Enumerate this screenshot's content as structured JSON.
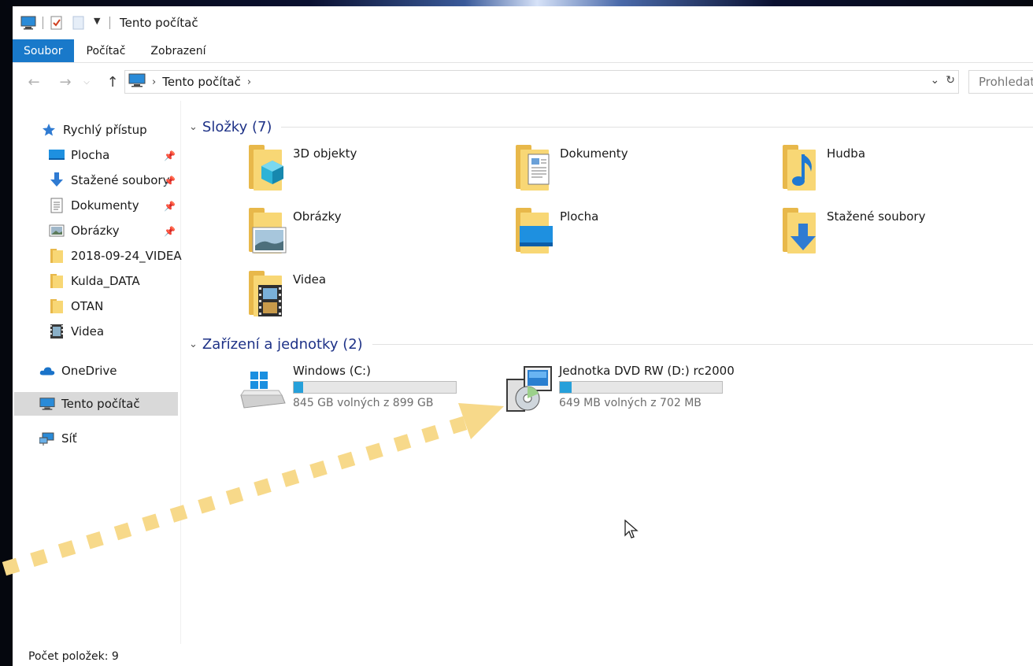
{
  "window": {
    "title": "Tento počítač",
    "colors": {
      "accent": "#1979ca",
      "group_title": "#1e3287",
      "drive_fill": "#26a0da",
      "annotation": "#f7d98a"
    }
  },
  "ribbon": {
    "tabs": [
      "Soubor",
      "Počítač",
      "Zobrazení"
    ]
  },
  "address": {
    "crumb": "Tento počítač",
    "search_placeholder": "Prohledat"
  },
  "sidebar": {
    "quick_access": "Rychlý přístup",
    "items": [
      {
        "label": "Plocha",
        "icon": "desktop-icon",
        "pinned": true
      },
      {
        "label": "Stažené soubory",
        "icon": "download-icon",
        "pinned": true
      },
      {
        "label": "Dokumenty",
        "icon": "document-icon",
        "pinned": true
      },
      {
        "label": "Obrázky",
        "icon": "pictures-icon",
        "pinned": true
      },
      {
        "label": "2018-09-24_VIDEA",
        "icon": "folder-icon",
        "pinned": false
      },
      {
        "label": "Kulda_DATA",
        "icon": "folder-icon",
        "pinned": false
      },
      {
        "label": "OTAN",
        "icon": "folder-icon",
        "pinned": false
      },
      {
        "label": "Videa",
        "icon": "video-icon",
        "pinned": false
      }
    ],
    "onedrive": "OneDrive",
    "this_pc": "Tento počítač",
    "network": "Síť"
  },
  "folders_group": {
    "title": "Složky (7)",
    "items": [
      {
        "label": "3D objekty",
        "icon": "3d-objects-icon"
      },
      {
        "label": "Dokumenty",
        "icon": "documents-folder-icon"
      },
      {
        "label": "Hudba",
        "icon": "music-folder-icon"
      },
      {
        "label": "Obrázky",
        "icon": "pictures-folder-icon"
      },
      {
        "label": "Plocha",
        "icon": "desktop-folder-icon"
      },
      {
        "label": "Stažené soubory",
        "icon": "downloads-folder-icon"
      },
      {
        "label": "Videa",
        "icon": "videos-folder-icon"
      }
    ]
  },
  "devices_group": {
    "title": "Zařízení a jednotky (2)",
    "drives": [
      {
        "label": "Windows (C:)",
        "free": "845 GB volných z 899 GB",
        "used_fraction": 0.06,
        "icon": "hard-drive-icon"
      },
      {
        "label": "Jednotka DVD RW (D:) rc2000",
        "free": "649 MB volných z 702 MB",
        "used_fraction": 0.075,
        "icon": "dvd-setup-icon"
      }
    ]
  },
  "status": {
    "item_count": "Počet položek: 9"
  }
}
